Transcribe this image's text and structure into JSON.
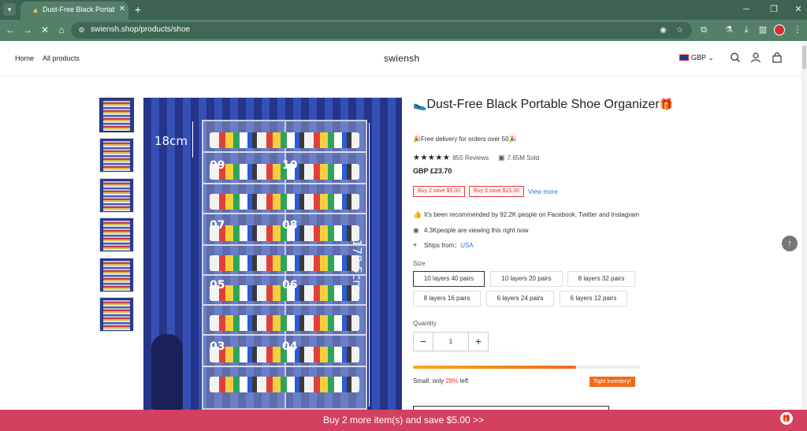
{
  "browser": {
    "tab_title": "Dust-Free Black Portable Sh",
    "url": "swiensh.shop/products/shoe"
  },
  "site": {
    "brand": "swiensh",
    "nav": [
      "Home",
      "All products"
    ],
    "currency": "GBP"
  },
  "product": {
    "title": "Dust-Free Black Portable Shoe Organizer",
    "title_prefix_icon": "🥿",
    "title_suffix_icon": "🎁",
    "free_delivery": "🎉Free delivery for orders over 50🎉",
    "stars": "★★★★★",
    "reviews": "855 Reviews",
    "sold": "7.65M Sold",
    "price": "GBP £23.70",
    "promos": [
      "Buy 2 save $5.00",
      "Buy 3 save $15.00"
    ],
    "view_more": "View more",
    "recommended": "It's been recommended by 92.2K people on Facebook, Twitter and Instagram",
    "viewing": "4.3Kpeople are viewing this right now",
    "ships_from_label": "Ships from：",
    "ships_from_value": "USA",
    "size_label": "Size",
    "sizes": [
      "10 layers 40 pairs",
      "10 layers 20 pairs",
      "8 layers 32 pairs",
      "8 layers 16 pairs",
      "6 layers 24 pairs",
      "6 layers 12 pairs"
    ],
    "selected_size": "10 layers 40 pairs",
    "quantity_label": "Quantity",
    "quantity": "1",
    "stock_prefix": "Small: only ",
    "stock_pct": "28%",
    "stock_suffix": " left",
    "stock_fill_percent": 72,
    "tight_inventory": "Tight inventory!"
  },
  "image": {
    "dim_height": "178.5cm",
    "dim_layer": "18cm",
    "shelf_numbers": [
      "09",
      "10",
      "07",
      "08",
      "05",
      "06",
      "03",
      "04"
    ]
  },
  "bottom_bar": {
    "text": "Buy 2 more item(s) and save $5.00  >>"
  },
  "colors": {
    "browser_frame": "#3d6450",
    "promo_red": "#e23b3b",
    "link_blue": "#2a7ad8",
    "bottom_bar": "#d44060",
    "badge_orange": "#f26a1b"
  }
}
